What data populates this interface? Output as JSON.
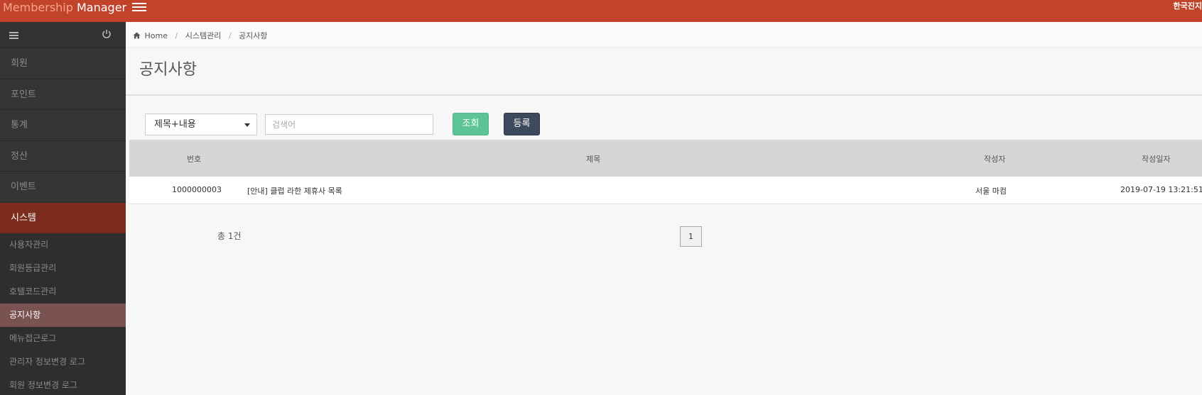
{
  "header": {
    "brand_part1": "Membership",
    "brand_part2": "Manager",
    "language": "한국진지"
  },
  "sidebar": {
    "items": [
      {
        "label": "회원"
      },
      {
        "label": "포인트"
      },
      {
        "label": "통계"
      },
      {
        "label": "정산"
      },
      {
        "label": "이벤트"
      },
      {
        "label": "시스템"
      }
    ],
    "sub_items": [
      {
        "label": "사용자관리"
      },
      {
        "label": "회원등급관리"
      },
      {
        "label": "호텔코드관리"
      },
      {
        "label": "공지사항"
      },
      {
        "label": "메뉴접근로그"
      },
      {
        "label": "관리자 정보변경 로그"
      },
      {
        "label": "회원 정보변경 로그"
      }
    ]
  },
  "breadcrumb": {
    "home": "Home",
    "level1": "시스템관리",
    "level2": "공지사항"
  },
  "page": {
    "title": "공지사항"
  },
  "search": {
    "filter_value": "제목+내용",
    "placeholder": "검색어",
    "search_button": "조회",
    "register_button": "등록"
  },
  "table": {
    "headers": {
      "number": "번호",
      "title": "제목",
      "author": "작성자",
      "date": "작성일자"
    },
    "rows": [
      {
        "number": "1000000003",
        "title": "[안내] 클럽 라한 제휴사 목록",
        "author": "서울 마컴",
        "date": "2019-07-19 13:21:51"
      }
    ]
  },
  "pagination": {
    "total": "총 1건",
    "current_page": "1"
  },
  "colors": {
    "topbar": "#c0432a",
    "sidebar": "#323232",
    "active_menu": "#7c2c1d",
    "search_button": "#5cc495",
    "register_button": "#3d4a5d"
  }
}
